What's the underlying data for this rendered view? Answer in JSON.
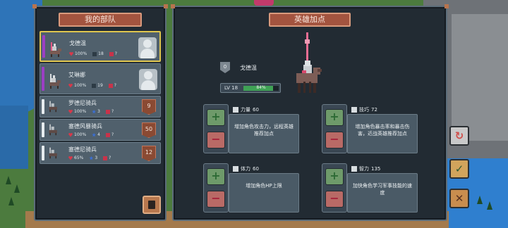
{
  "left_panel": {
    "title": "我的部队",
    "units": [
      {
        "name": "戈德温",
        "kind": "hero",
        "hp": "100%",
        "boot": "18",
        "skill": "?",
        "selected": true
      },
      {
        "name": "艾琳娜",
        "kind": "hero",
        "hp": "100%",
        "boot": "19",
        "skill": "?",
        "selected": false
      },
      {
        "name": "罗德尼骑兵",
        "kind": "troop",
        "hp": "100%",
        "star": "3",
        "skill": "?",
        "count": "9"
      },
      {
        "name": "塞德风暴骑兵",
        "kind": "troop",
        "hp": "100%",
        "star": "4",
        "skill": "?",
        "count": "50"
      },
      {
        "name": "塞德尼骑兵",
        "kind": "troop",
        "hp": "65%",
        "star": "3",
        "skill": "?",
        "count": "12"
      }
    ],
    "corner_button_icon": "book-icon"
  },
  "right_panel": {
    "title": "英雄加点",
    "hero": {
      "rank": "0",
      "name": "戈德温",
      "level_label": "LV 18",
      "xp_text": "84%",
      "xp_fraction": 0.84
    },
    "attributes": [
      {
        "name": "力量",
        "value": "60",
        "desc": "增加角色攻击力，远程英雄推荐加点"
      },
      {
        "name": "技巧",
        "value": "72",
        "desc": "增加角色暴击率和暴击伤害，近战英雄推荐加点"
      },
      {
        "name": "体力",
        "value": "60",
        "desc": "增加角色HP上限"
      },
      {
        "name": "智力",
        "value": "135",
        "desc": "加快角色学习军事技能的速度"
      }
    ],
    "plus_label": "+",
    "minus_label": "−"
  },
  "side_buttons": {
    "refresh_glyph": "↻",
    "confirm_glyph": "✓",
    "cancel_glyph": "✕"
  },
  "colors": {
    "selected_border": "#e0c64e",
    "xp_fill": "#3fa255",
    "title_bg": "#a3543f",
    "hero_stripe": "#9b3fc4"
  }
}
